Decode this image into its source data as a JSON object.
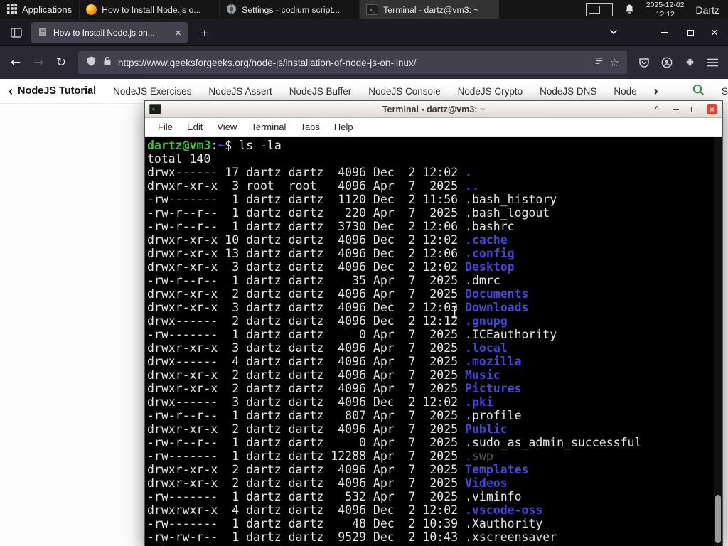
{
  "panel": {
    "applications": "Applications",
    "tasks": [
      {
        "title": "How to Install Node.js o...",
        "icon": "firefox-icon"
      },
      {
        "title": "Settings - codium script...",
        "icon": "settings-icon"
      },
      {
        "title": "Terminal - dartz@vm3: ~",
        "icon": "terminal-icon"
      }
    ],
    "clock_date": "2025-12-02",
    "clock_time": "12:12",
    "user": "Dartz"
  },
  "browser": {
    "tab_title": "How to Install Node.js on...",
    "new_tab_label": "+",
    "url": "https://www.geeksforgeeks.org/node-js/installation-of-node-js-on-linux/",
    "back_glyph": "←",
    "forward_glyph": "→",
    "reload_glyph": "↻",
    "star_glyph": "☆",
    "close_glyph": "×",
    "site_nav": {
      "left_chevron": "‹",
      "active": "NodeJS Tutorial",
      "links": [
        "NodeJS Exercises",
        "NodeJS Assert",
        "NodeJS Buffer",
        "NodeJS Console",
        "NodeJS Crypto",
        "NodeJS DNS",
        "Node"
      ],
      "right_chevron": "›",
      "sign_in": "Sign In"
    }
  },
  "terminal": {
    "title": "Terminal - dartz@vm3: ~",
    "menus": [
      "File",
      "Edit",
      "View",
      "Terminal",
      "Tabs",
      "Help"
    ],
    "shade_glyph": "^",
    "close_glyph": "×",
    "prompt_user": "dartz@vm3",
    "prompt_sep": ":",
    "prompt_path": "~",
    "prompt_sign": "$",
    "command": " ls -la",
    "total": "total 140",
    "listing": [
      {
        "pre": "drwx------ 17 dartz dartz  4096 Dec  2 12:02 ",
        "name": ".",
        "type": "dir"
      },
      {
        "pre": "drwxr-xr-x  3 root  root   4096 Apr  7  2025 ",
        "name": "..",
        "type": "dir"
      },
      {
        "pre": "-rw-------  1 dartz dartz  1120 Dec  2 11:56 ",
        "name": ".bash_history",
        "type": "file"
      },
      {
        "pre": "-rw-r--r--  1 dartz dartz   220 Apr  7  2025 ",
        "name": ".bash_logout",
        "type": "file"
      },
      {
        "pre": "-rw-r--r--  1 dartz dartz  3730 Dec  2 12:06 ",
        "name": ".bashrc",
        "type": "file"
      },
      {
        "pre": "drwxr-xr-x 10 dartz dartz  4096 Dec  2 12:02 ",
        "name": ".cache",
        "type": "dir"
      },
      {
        "pre": "drwxr-xr-x 13 dartz dartz  4096 Dec  2 12:06 ",
        "name": ".config",
        "type": "dir"
      },
      {
        "pre": "drwxr-xr-x  3 dartz dartz  4096 Dec  2 12:02 ",
        "name": "Desktop",
        "type": "dir"
      },
      {
        "pre": "-rw-r--r--  1 dartz dartz    35 Apr  7  2025 ",
        "name": ".dmrc",
        "type": "file"
      },
      {
        "pre": "drwxr-xr-x  2 dartz dartz  4096 Apr  7  2025 ",
        "name": "Documents",
        "type": "dir"
      },
      {
        "pre": "drwxr-xr-x  3 dartz dartz  4096 Dec  2 12:03 ",
        "name": "Downloads",
        "type": "dir"
      },
      {
        "pre": "drwx------  2 dartz dartz  4096 Dec  2 12:12 ",
        "name": ".gnupg",
        "type": "dir"
      },
      {
        "pre": "-rw-------  1 dartz dartz     0 Apr  7  2025 ",
        "name": ".ICEauthority",
        "type": "file"
      },
      {
        "pre": "drwxr-xr-x  3 dartz dartz  4096 Apr  7  2025 ",
        "name": ".local",
        "type": "dir"
      },
      {
        "pre": "drwx------  4 dartz dartz  4096 Apr  7  2025 ",
        "name": ".mozilla",
        "type": "dir"
      },
      {
        "pre": "drwxr-xr-x  2 dartz dartz  4096 Apr  7  2025 ",
        "name": "Music",
        "type": "dir"
      },
      {
        "pre": "drwxr-xr-x  2 dartz dartz  4096 Apr  7  2025 ",
        "name": "Pictures",
        "type": "dir"
      },
      {
        "pre": "drwx------  3 dartz dartz  4096 Dec  2 12:02 ",
        "name": ".pki",
        "type": "dir"
      },
      {
        "pre": "-rw-r--r--  1 dartz dartz   807 Apr  7  2025 ",
        "name": ".profile",
        "type": "file"
      },
      {
        "pre": "drwxr-xr-x  2 dartz dartz  4096 Apr  7  2025 ",
        "name": "Public",
        "type": "dir"
      },
      {
        "pre": "-rw-r--r--  1 dartz dartz     0 Apr  7  2025 ",
        "name": ".sudo_as_admin_successful",
        "type": "file"
      },
      {
        "pre": "-rw-------  1 dartz dartz 12288 Apr  7  2025 ",
        "name": ".swp",
        "type": "muted"
      },
      {
        "pre": "drwxr-xr-x  2 dartz dartz  4096 Apr  7  2025 ",
        "name": "Templates",
        "type": "dir"
      },
      {
        "pre": "drwxr-xr-x  2 dartz dartz  4096 Apr  7  2025 ",
        "name": "Videos",
        "type": "dir"
      },
      {
        "pre": "-rw-------  1 dartz dartz   532 Apr  7  2025 ",
        "name": ".viminfo",
        "type": "file"
      },
      {
        "pre": "drwxrwxr-x  4 dartz dartz  4096 Dec  2 12:02 ",
        "name": ".vscode-oss",
        "type": "dir"
      },
      {
        "pre": "-rw-------  1 dartz dartz    48 Dec  2 10:39 ",
        "name": ".Xauthority",
        "type": "file"
      },
      {
        "pre": "-rw-rw-r--  1 dartz dartz  9529 Dec  2 10:43 ",
        "name": ".xscreensaver",
        "type": "file"
      }
    ]
  },
  "colors": {
    "term_green": "#3fc23f",
    "term_blue": "#4547d9",
    "term_fg": "#e6e5e3",
    "term_muted": "#5a5a5a",
    "gfg_green": "#2f8d46",
    "close_red": "#d64937"
  }
}
